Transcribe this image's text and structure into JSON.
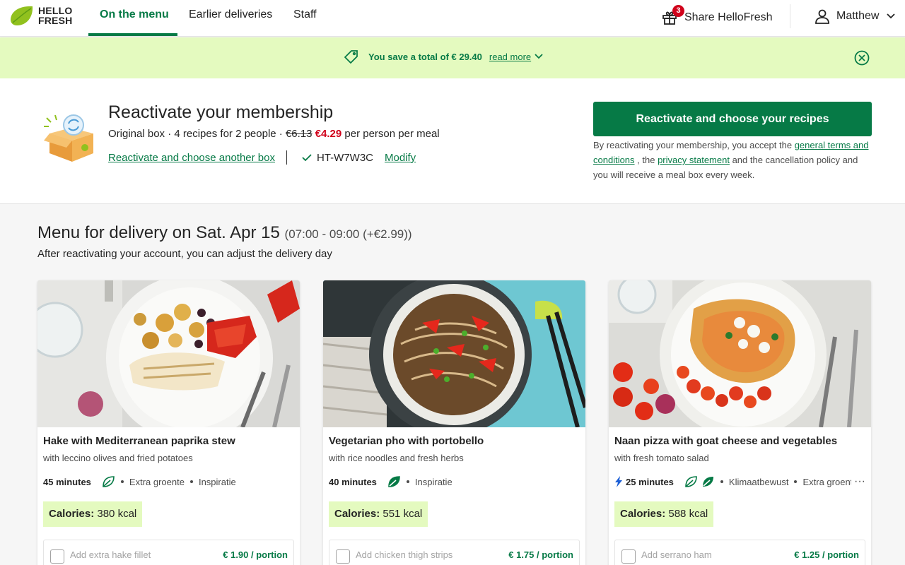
{
  "header": {
    "logo_line1": "HELLO",
    "logo_line2": "FRESH",
    "tabs": [
      {
        "label": "On the menu",
        "active": true
      },
      {
        "label": "Earlier deliveries",
        "active": false
      },
      {
        "label": "Staff",
        "active": false
      }
    ],
    "share_label": "Share HelloFresh",
    "share_badge": "3",
    "user_name": "Matthew"
  },
  "banner": {
    "text": "You save a total of € 29.40",
    "link": "read more"
  },
  "reactivate": {
    "title": "Reactivate your membership",
    "box_desc": "Original box · 4 recipes for 2 people · ",
    "old_price": "€6.13",
    "new_price": "€4.29",
    "price_suffix": " per person per meal",
    "choose_box_link": "Reactivate and choose another box",
    "code": "HT-W7W3C",
    "modify_link": "Modify",
    "cta_label": "Reactivate and choose your recipes",
    "terms_prefix": "By reactivating your membership, you accept the ",
    "terms_link1": "general terms and conditions",
    "terms_mid": " , the ",
    "terms_link2": "privacy statement",
    "terms_suffix": " and the cancellation policy and you will receive a meal box every week."
  },
  "menu": {
    "title": "Menu for delivery on Sat. Apr 15",
    "slot": "(07:00 - 09:00 (+€2.99))",
    "subtitle": "After reactivating your account, you can adjust the delivery day"
  },
  "recipes": [
    {
      "title": "Hake with Mediterranean paprika stew",
      "subtitle": "with leccino olives and fried potatoes",
      "time": "45 minutes",
      "tags": [
        "Extra groente",
        "Inspiratie"
      ],
      "calories_label": "Calories:",
      "calories": "380 kcal",
      "addon": "Add extra hake fillet",
      "addon_price": "€ 1.90 / portion"
    },
    {
      "title": "Vegetarian pho with portobello",
      "subtitle": "with rice noodles and fresh herbs",
      "time": "40 minutes",
      "tags": [
        "Inspiratie"
      ],
      "calories_label": "Calories:",
      "calories": "551 kcal",
      "addon": "Add chicken thigh strips",
      "addon_price": "€ 1.75 / portion"
    },
    {
      "title": "Naan pizza with goat cheese and vegetables",
      "subtitle": "with fresh tomato salad",
      "time": "25 minutes",
      "tags": [
        "Klimaatbewust",
        "Extra groente"
      ],
      "calories_label": "Calories:",
      "calories": "588 kcal",
      "addon": "Add serrano ham",
      "addon_price": "€ 1.25 / portion"
    }
  ],
  "colors": {
    "brand_green": "#067a46",
    "banner_bg": "#e4fabf",
    "badge_red": "#d0021b",
    "logo_green": "#91c11e"
  }
}
